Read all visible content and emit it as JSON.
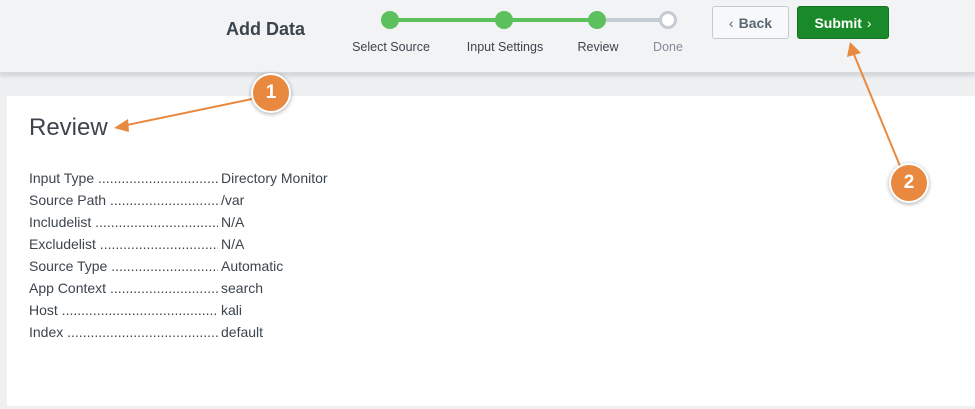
{
  "header": {
    "title": "Add Data",
    "steps": [
      {
        "label": "Select Source",
        "status": "complete"
      },
      {
        "label": "Input Settings",
        "status": "complete"
      },
      {
        "label": "Review",
        "status": "current"
      },
      {
        "label": "Done",
        "status": "pending"
      }
    ],
    "back_label": "Back",
    "submit_label": "Submit",
    "back_icon": "chevron-left-icon",
    "submit_icon": "chevron-right-icon"
  },
  "review": {
    "heading": "Review",
    "rows": [
      {
        "label": "Input Type",
        "value": "Directory Monitor"
      },
      {
        "label": "Source Path",
        "value": "/var"
      },
      {
        "label": "Includelist",
        "value": "N/A"
      },
      {
        "label": "Excludelist",
        "value": "N/A"
      },
      {
        "label": "Source Type",
        "value": "Automatic"
      },
      {
        "label": "App Context",
        "value": "search"
      },
      {
        "label": "Host",
        "value": "kali"
      },
      {
        "label": "Index",
        "value": "default"
      }
    ]
  },
  "annotations": [
    "1",
    "2"
  ],
  "colors": {
    "accent_green": "#5cc05c",
    "submit_green": "#1a8929",
    "annotation_orange": "#e8893f"
  }
}
